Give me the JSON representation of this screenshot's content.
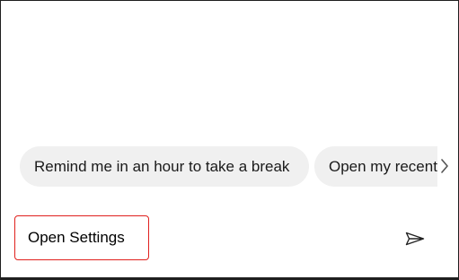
{
  "suggestions": {
    "items": [
      {
        "label": "Remind me in an hour to take a break"
      },
      {
        "label": "Open my recent"
      }
    ],
    "next_icon": "chevron-right-icon"
  },
  "input": {
    "value": "Open Settings"
  },
  "send": {
    "icon": "send-icon"
  },
  "colors": {
    "chip_background": "#f0f0f0",
    "highlight_border": "#e0201d",
    "window_border": "#1f1f1f"
  }
}
